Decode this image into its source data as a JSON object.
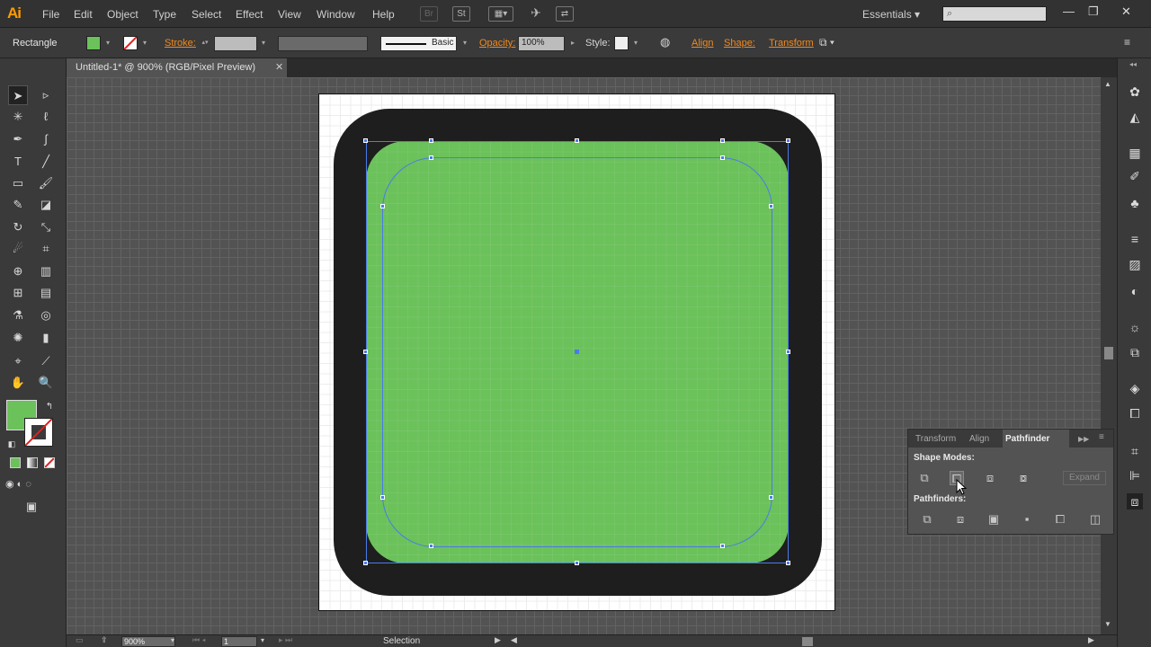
{
  "app": {
    "logo": "Ai"
  },
  "menu": [
    "File",
    "Edit",
    "Object",
    "Type",
    "Select",
    "Effect",
    "View",
    "Window",
    "Help"
  ],
  "menubar_icons": {
    "bridge": "Br",
    "stock": "St"
  },
  "workspace": "Essentials",
  "window_controls": {
    "minimize": "—",
    "restore": "❐",
    "close": "✕"
  },
  "control_bar": {
    "selection_type": "Rectangle",
    "stroke_label": "Stroke:",
    "brush_label": "Basic",
    "opacity_label": "Opacity:",
    "opacity_value": "100%",
    "style_label": "Style:",
    "align_label": "Align",
    "shape_label": "Shape:",
    "transform_label": "Transform",
    "fill_color": "#6bc15a"
  },
  "document": {
    "tab_title": "Untitled-1* @ 900% (RGB/Pixel Preview)",
    "close": "✕"
  },
  "status": {
    "zoom": "900%",
    "page": "1",
    "tool": "Selection"
  },
  "pathfinder_panel": {
    "tabs": [
      "Transform",
      "Align",
      "Pathfinder"
    ],
    "active_tab": "Pathfinder",
    "shape_modes_label": "Shape Modes:",
    "pathfinders_label": "Pathfinders:",
    "expand_label": "Expand"
  },
  "colors": {
    "accent_orange": "#f28a1c",
    "selection_blue": "#4a7bea",
    "fill_green": "#6bc15a",
    "shape_dark": "#1e1e1e"
  }
}
